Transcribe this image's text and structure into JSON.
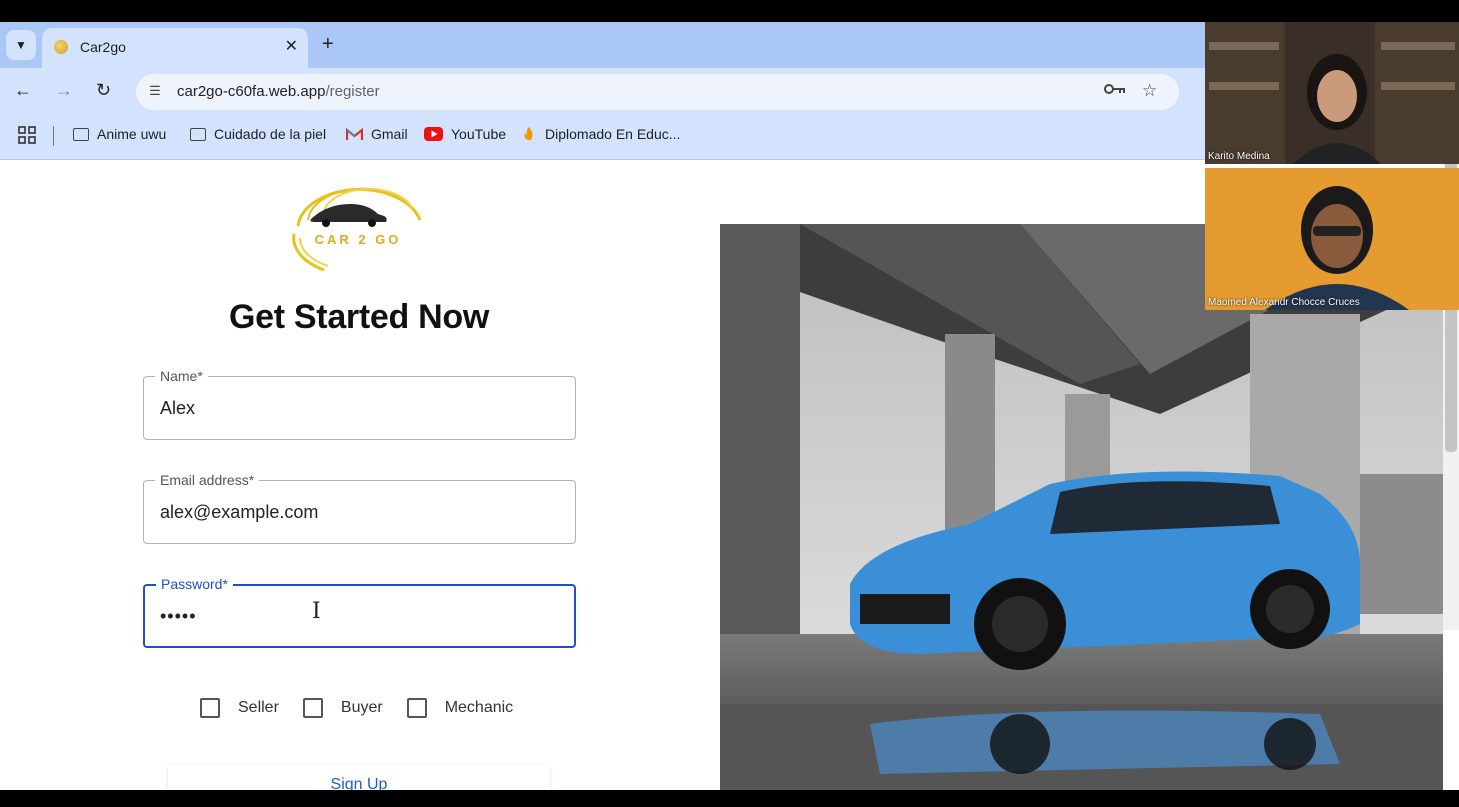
{
  "browser": {
    "tab_title": "Car2go",
    "url_host": "car2go-c60fa.web.app",
    "url_path": "/register",
    "bookmarks": [
      {
        "label": "Anime uwu",
        "icon": "folder-icon"
      },
      {
        "label": "Cuidado de la piel",
        "icon": "folder-icon"
      },
      {
        "label": "Gmail",
        "icon": "gmail-icon"
      },
      {
        "label": "YouTube",
        "icon": "youtube-icon"
      },
      {
        "label": "Diplomado En Educ...",
        "icon": "diplomado-icon"
      }
    ]
  },
  "page": {
    "logo_text": "CAR 2 GO",
    "heading": "Get Started Now",
    "fields": {
      "name": {
        "label": "Name*",
        "value": "Alex"
      },
      "email": {
        "label": "Email address*",
        "value": "alex@example.com"
      },
      "password": {
        "label": "Password*",
        "value": "•••••"
      }
    },
    "roles": [
      "Seller",
      "Buyer",
      "Mechanic"
    ],
    "signup_label": "Sign Up"
  },
  "meeting": {
    "participants": [
      "Karito Medina",
      "Maomed Alexandr Chocce Cruces"
    ]
  },
  "colors": {
    "accent": "#1f4fc9",
    "chrome": "#d3e3fd",
    "tabstrip": "#aac7f5",
    "car": "#3a8fd6"
  }
}
